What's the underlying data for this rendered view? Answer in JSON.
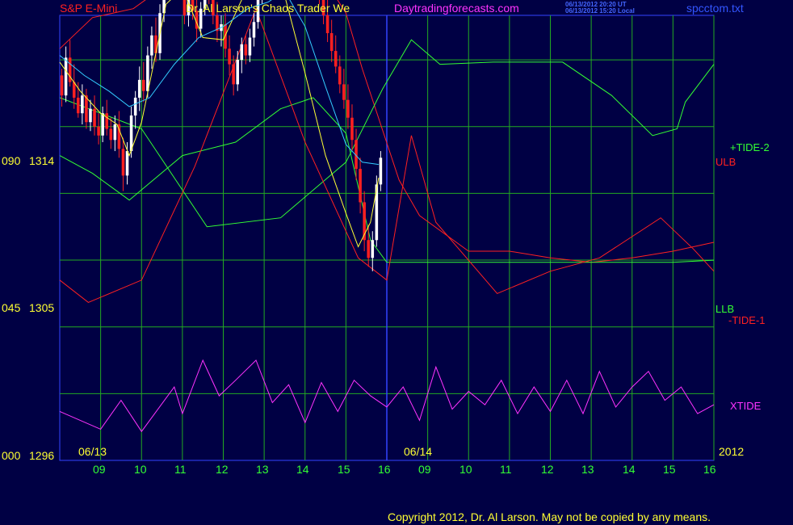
{
  "header": {
    "instrument": "S&P E-Mini",
    "title": "Dr. Al Larson's Chaos Trader We",
    "website": "Daytradingforecasts.com",
    "stamp_ut": "06/13/2012 20:20 UT",
    "stamp_local": "06/13/2012 15:20 Local",
    "filename": "spcctom.txt"
  },
  "y_axis": {
    "labels": [
      {
        "pct": "090",
        "price": "1314"
      },
      {
        "pct": "045",
        "price": "1305"
      },
      {
        "pct": "000",
        "price": "1296"
      }
    ]
  },
  "x_axis": {
    "dates": [
      "06/13",
      "06/14"
    ],
    "year": "2012",
    "hours": [
      "09",
      "10",
      "11",
      "12",
      "13",
      "14",
      "15",
      "16",
      "09",
      "10",
      "11",
      "12",
      "13",
      "14",
      "15",
      "16"
    ]
  },
  "legend": {
    "tide2": "+TIDE-2",
    "ulb": "ULB",
    "llb": "LLB",
    "tide1": "-TIDE-1",
    "xtide": "XTIDE"
  },
  "footer": {
    "copyright": "Copyright 2012, Dr. Al Larson. May not be copied by any means."
  },
  "colors": {
    "background": "#000044",
    "grid": "#22aa22",
    "price_up": "#ffffff",
    "price_down": "#ff2020",
    "average_fast": "#ffff33",
    "average_slow": "#33ccff",
    "upper_band": "#ff2020",
    "lower_band": "#33ff33",
    "xtide": "#ff33ff",
    "divider": "#3344ff"
  },
  "chart_data": {
    "type": "line",
    "ylim": [
      1296,
      1316
    ],
    "y_ticks": [
      1296,
      1305,
      1314
    ],
    "series": [
      {
        "name": "+TIDE-2",
        "color": "#33ff33",
        "x": [
          0,
          2,
          3.6,
          5.4,
          7,
          7.9,
          8.6,
          9.3,
          10.6,
          12.3,
          13.5,
          14.5,
          15.1,
          15.3,
          16
        ],
        "values": [
          1312.3,
          1310.9,
          1306.5,
          1306.9,
          1309.4,
          1312.7,
          1314.9,
          1313.8,
          1313.9,
          1313.9,
          1312.4,
          1310.6,
          1310.9,
          1312.1,
          1313.8
        ]
      },
      {
        "name": "-TIDE-1",
        "color": "#ff2020",
        "x": [
          0,
          0.7,
          2,
          3.3,
          4.8,
          6,
          7.3,
          8,
          8.6,
          9.2,
          10.7,
          12,
          13.2,
          14.7,
          15.5,
          16
        ],
        "values": [
          1304.1,
          1303.1,
          1304.1,
          1309.2,
          1316.3,
          1310.3,
          1305.1,
          1304.1,
          1310.6,
          1306.7,
          1303.5,
          1304.5,
          1305.1,
          1306.9,
          1305.5,
          1304.5
        ]
      },
      {
        "name": "XTIDE",
        "color": "#ff33ff",
        "x": [
          0,
          1,
          1.5,
          2,
          2.8,
          3,
          3.5,
          3.9,
          4.3,
          4.8,
          5.2,
          5.6,
          6,
          6.4,
          6.8,
          7.2,
          7.6,
          8,
          8.4,
          8.8,
          9.2,
          9.6,
          10,
          10.4,
          10.8,
          11.2,
          11.6,
          12,
          12.4,
          12.8,
          13.2,
          13.6,
          14,
          14.4,
          14.8,
          15.2,
          15.6,
          16
        ],
        "values": [
          1298.2,
          1297.4,
          1298.7,
          1297.3,
          1299.3,
          1298.1,
          1300.5,
          1298.9,
          1299.6,
          1300.5,
          1298.6,
          1299.4,
          1297.7,
          1299.5,
          1298.2,
          1299.6,
          1298.9,
          1298.4,
          1299.3,
          1297.8,
          1300.2,
          1298.3,
          1299.1,
          1298.5,
          1299.6,
          1298.1,
          1299.3,
          1298.2,
          1299.6,
          1298.1,
          1300.0,
          1298.4,
          1299.3,
          1300.0,
          1298.7,
          1299.3,
          1298.1,
          1298.5
        ]
      }
    ],
    "bands": [
      {
        "name": "ULB",
        "color": "#ff2020",
        "x": [
          0,
          0.8,
          1.8,
          3,
          4.7,
          5.4,
          6.2,
          7,
          7.4,
          8.3,
          8.8,
          10,
          11,
          12,
          13,
          14,
          15,
          16
        ],
        "values": [
          1314.5,
          1315.9,
          1316.3,
          1317.9,
          1319.5,
          1319.8,
          1318.4,
          1316.1,
          1313.6,
          1308.6,
          1307.0,
          1305.4,
          1305.4,
          1305.1,
          1304.9,
          1305.1,
          1305.4,
          1305.8
        ]
      },
      {
        "name": "LLB",
        "color": "#33ff33",
        "x": [
          0,
          0.8,
          1.7,
          3,
          4.3,
          5.4,
          6.2,
          7,
          7.3,
          7.6,
          8,
          10,
          12,
          13,
          14,
          15,
          16
        ],
        "values": [
          1309.7,
          1308.9,
          1307.7,
          1309.7,
          1310.3,
          1311.8,
          1312.3,
          1310.7,
          1308.3,
          1305.9,
          1304.9,
          1304.9,
          1304.9,
          1304.9,
          1304.9,
          1304.9,
          1305.0
        ]
      }
    ],
    "averages": [
      {
        "name": "fast",
        "color": "#ffff33",
        "x": [
          0,
          0.5,
          1,
          1.4,
          1.7,
          2,
          2.6,
          3,
          3.5,
          4,
          4.6,
          5.1,
          5.5,
          6,
          6.5,
          7,
          7.3,
          7.6,
          7.8
        ],
        "values": [
          1313.9,
          1312.6,
          1311.6,
          1311.1,
          1309.7,
          1311.2,
          1316.5,
          1317.2,
          1315.0,
          1314.9,
          1317.3,
          1317.6,
          1316.9,
          1313.4,
          1309.7,
          1307.1,
          1305.6,
          1306.7,
          1308.7
        ]
      },
      {
        "name": "slow",
        "color": "#33ccff",
        "x": [
          0,
          0.6,
          1.2,
          1.7,
          2.2,
          2.8,
          3.4,
          4,
          4.6,
          5.1,
          5.5,
          6,
          6.5,
          7,
          7.4,
          7.8
        ],
        "values": [
          1314.2,
          1313.3,
          1312.6,
          1311.9,
          1312.3,
          1313.8,
          1315.0,
          1315.5,
          1316.3,
          1316.6,
          1317.1,
          1315.5,
          1312.8,
          1310.2,
          1309.4,
          1309.3
        ]
      }
    ],
    "price": [
      {
        "x": 0.05,
        "o": 1313.3,
        "h": 1313.6,
        "l": 1311.9,
        "c": 1312.4
      },
      {
        "x": 0.15,
        "o": 1312.4,
        "h": 1314.6,
        "l": 1312.1,
        "c": 1314.1
      },
      {
        "x": 0.25,
        "o": 1314.1,
        "h": 1314.9,
        "l": 1312.8,
        "c": 1313.0
      },
      {
        "x": 0.35,
        "o": 1313.0,
        "h": 1313.8,
        "l": 1311.8,
        "c": 1312.3
      },
      {
        "x": 0.45,
        "o": 1312.3,
        "h": 1313.0,
        "l": 1311.4,
        "c": 1311.6
      },
      {
        "x": 0.55,
        "o": 1311.6,
        "h": 1312.9,
        "l": 1311.1,
        "c": 1312.4
      },
      {
        "x": 0.65,
        "o": 1312.4,
        "h": 1312.7,
        "l": 1310.9,
        "c": 1311.2
      },
      {
        "x": 0.75,
        "o": 1311.2,
        "h": 1312.2,
        "l": 1310.8,
        "c": 1311.8
      },
      {
        "x": 0.85,
        "o": 1311.8,
        "h": 1312.4,
        "l": 1310.6,
        "c": 1311.0
      },
      {
        "x": 0.95,
        "o": 1311.0,
        "h": 1311.6,
        "l": 1310.2,
        "c": 1310.6
      },
      {
        "x": 1.05,
        "o": 1310.6,
        "h": 1311.9,
        "l": 1310.3,
        "c": 1311.6
      },
      {
        "x": 1.15,
        "o": 1311.6,
        "h": 1312.2,
        "l": 1310.6,
        "c": 1310.9
      },
      {
        "x": 1.25,
        "o": 1310.9,
        "h": 1311.4,
        "l": 1310.0,
        "c": 1310.4
      },
      {
        "x": 1.35,
        "o": 1310.4,
        "h": 1311.5,
        "l": 1309.9,
        "c": 1311.1
      },
      {
        "x": 1.45,
        "o": 1311.1,
        "h": 1311.7,
        "l": 1309.6,
        "c": 1310.0
      },
      {
        "x": 1.55,
        "o": 1310.0,
        "h": 1310.5,
        "l": 1308.1,
        "c": 1308.8
      },
      {
        "x": 1.65,
        "o": 1308.8,
        "h": 1310.3,
        "l": 1308.4,
        "c": 1309.9
      },
      {
        "x": 1.75,
        "o": 1309.9,
        "h": 1311.9,
        "l": 1309.6,
        "c": 1311.5
      },
      {
        "x": 1.85,
        "o": 1311.5,
        "h": 1312.6,
        "l": 1310.9,
        "c": 1312.3
      },
      {
        "x": 1.95,
        "o": 1312.3,
        "h": 1313.7,
        "l": 1311.7,
        "c": 1313.1
      },
      {
        "x": 2.05,
        "o": 1313.1,
        "h": 1313.9,
        "l": 1312.1,
        "c": 1312.6
      },
      {
        "x": 2.15,
        "o": 1312.6,
        "h": 1314.6,
        "l": 1312.3,
        "c": 1314.2
      },
      {
        "x": 2.25,
        "o": 1314.2,
        "h": 1315.5,
        "l": 1313.6,
        "c": 1315.1
      },
      {
        "x": 2.35,
        "o": 1315.1,
        "h": 1315.9,
        "l": 1313.9,
        "c": 1314.3
      },
      {
        "x": 2.45,
        "o": 1314.3,
        "h": 1316.5,
        "l": 1314.0,
        "c": 1316.1
      },
      {
        "x": 2.55,
        "o": 1316.1,
        "h": 1318.0,
        "l": 1315.7,
        "c": 1317.5
      },
      {
        "x": 2.65,
        "o": 1317.5,
        "h": 1318.6,
        "l": 1316.9,
        "c": 1318.1
      },
      {
        "x": 2.75,
        "o": 1318.1,
        "h": 1319.4,
        "l": 1317.6,
        "c": 1318.9
      },
      {
        "x": 2.85,
        "o": 1318.9,
        "h": 1319.3,
        "l": 1317.8,
        "c": 1318.2
      },
      {
        "x": 2.95,
        "o": 1318.2,
        "h": 1318.6,
        "l": 1316.7,
        "c": 1317.2
      },
      {
        "x": 3.05,
        "o": 1317.2,
        "h": 1317.7,
        "l": 1315.6,
        "c": 1316.0
      },
      {
        "x": 3.15,
        "o": 1316.0,
        "h": 1317.1,
        "l": 1315.5,
        "c": 1316.8
      },
      {
        "x": 3.25,
        "o": 1316.8,
        "h": 1317.3,
        "l": 1315.8,
        "c": 1316.2
      },
      {
        "x": 3.35,
        "o": 1316.2,
        "h": 1316.9,
        "l": 1314.8,
        "c": 1315.4
      },
      {
        "x": 3.45,
        "o": 1315.4,
        "h": 1316.6,
        "l": 1315.0,
        "c": 1316.3
      },
      {
        "x": 3.55,
        "o": 1316.3,
        "h": 1317.8,
        "l": 1316.0,
        "c": 1317.2
      },
      {
        "x": 3.65,
        "o": 1317.2,
        "h": 1318.1,
        "l": 1316.5,
        "c": 1316.9
      },
      {
        "x": 3.75,
        "o": 1316.9,
        "h": 1317.3,
        "l": 1315.6,
        "c": 1316.0
      },
      {
        "x": 3.85,
        "o": 1316.0,
        "h": 1316.6,
        "l": 1314.8,
        "c": 1315.3
      },
      {
        "x": 3.95,
        "o": 1315.3,
        "h": 1316.0,
        "l": 1314.6,
        "c": 1315.6
      },
      {
        "x": 4.05,
        "o": 1315.6,
        "h": 1316.1,
        "l": 1314.1,
        "c": 1314.5
      },
      {
        "x": 4.15,
        "o": 1314.5,
        "h": 1315.1,
        "l": 1313.3,
        "c": 1313.8
      },
      {
        "x": 4.25,
        "o": 1313.8,
        "h": 1314.2,
        "l": 1312.4,
        "c": 1312.9
      },
      {
        "x": 4.35,
        "o": 1312.9,
        "h": 1314.4,
        "l": 1312.6,
        "c": 1314.0
      },
      {
        "x": 4.45,
        "o": 1314.0,
        "h": 1315.0,
        "l": 1313.4,
        "c": 1314.7
      },
      {
        "x": 4.55,
        "o": 1314.7,
        "h": 1315.1,
        "l": 1313.8,
        "c": 1314.2
      },
      {
        "x": 4.65,
        "o": 1314.2,
        "h": 1315.4,
        "l": 1313.9,
        "c": 1315.0
      },
      {
        "x": 4.75,
        "o": 1315.0,
        "h": 1316.1,
        "l": 1314.6,
        "c": 1315.7
      },
      {
        "x": 4.85,
        "o": 1315.7,
        "h": 1317.2,
        "l": 1315.4,
        "c": 1316.8
      },
      {
        "x": 4.95,
        "o": 1316.8,
        "h": 1318.3,
        "l": 1316.5,
        "c": 1317.9
      },
      {
        "x": 5.05,
        "o": 1317.9,
        "h": 1319.1,
        "l": 1317.4,
        "c": 1318.6
      },
      {
        "x": 5.15,
        "o": 1318.6,
        "h": 1318.9,
        "l": 1317.0,
        "c": 1317.6
      },
      {
        "x": 5.25,
        "o": 1317.6,
        "h": 1318.2,
        "l": 1316.9,
        "c": 1317.9
      },
      {
        "x": 5.35,
        "o": 1317.9,
        "h": 1318.4,
        "l": 1316.8,
        "c": 1317.3
      },
      {
        "x": 5.45,
        "o": 1317.3,
        "h": 1318.2,
        "l": 1316.9,
        "c": 1317.8
      },
      {
        "x": 5.55,
        "o": 1317.8,
        "h": 1318.1,
        "l": 1316.9,
        "c": 1317.4
      },
      {
        "x": 5.65,
        "o": 1317.4,
        "h": 1318.3,
        "l": 1317.0,
        "c": 1317.9
      },
      {
        "x": 5.75,
        "o": 1317.9,
        "h": 1318.2,
        "l": 1316.8,
        "c": 1317.2
      },
      {
        "x": 5.85,
        "o": 1317.2,
        "h": 1318.1,
        "l": 1316.9,
        "c": 1317.8
      },
      {
        "x": 5.95,
        "o": 1317.8,
        "h": 1318.4,
        "l": 1317.1,
        "c": 1317.6
      },
      {
        "x": 6.05,
        "o": 1317.6,
        "h": 1318.6,
        "l": 1317.3,
        "c": 1318.2
      },
      {
        "x": 6.15,
        "o": 1318.2,
        "h": 1319.4,
        "l": 1317.9,
        "c": 1319.0
      },
      {
        "x": 6.25,
        "o": 1319.0,
        "h": 1319.3,
        "l": 1317.6,
        "c": 1318.0
      },
      {
        "x": 6.35,
        "o": 1318.0,
        "h": 1318.4,
        "l": 1316.5,
        "c": 1317.0
      },
      {
        "x": 6.45,
        "o": 1317.0,
        "h": 1317.3,
        "l": 1315.6,
        "c": 1316.0
      },
      {
        "x": 6.55,
        "o": 1316.0,
        "h": 1316.7,
        "l": 1314.8,
        "c": 1315.2
      },
      {
        "x": 6.65,
        "o": 1315.2,
        "h": 1315.8,
        "l": 1313.9,
        "c": 1314.4
      },
      {
        "x": 6.75,
        "o": 1314.4,
        "h": 1315.1,
        "l": 1313.4,
        "c": 1313.7
      },
      {
        "x": 6.85,
        "o": 1313.7,
        "h": 1314.2,
        "l": 1312.5,
        "c": 1312.9
      },
      {
        "x": 6.95,
        "o": 1312.9,
        "h": 1313.6,
        "l": 1311.8,
        "c": 1312.2
      },
      {
        "x": 7.05,
        "o": 1312.2,
        "h": 1312.9,
        "l": 1310.9,
        "c": 1311.4
      },
      {
        "x": 7.15,
        "o": 1311.4,
        "h": 1312.0,
        "l": 1309.9,
        "c": 1310.4
      },
      {
        "x": 7.25,
        "o": 1310.4,
        "h": 1310.9,
        "l": 1308.6,
        "c": 1309.1
      },
      {
        "x": 7.35,
        "o": 1309.1,
        "h": 1309.6,
        "l": 1307.1,
        "c": 1307.6
      },
      {
        "x": 7.45,
        "o": 1307.6,
        "h": 1308.1,
        "l": 1305.4,
        "c": 1305.9
      },
      {
        "x": 7.55,
        "o": 1305.9,
        "h": 1306.6,
        "l": 1304.7,
        "c": 1305.1
      },
      {
        "x": 7.65,
        "o": 1305.1,
        "h": 1306.3,
        "l": 1304.5,
        "c": 1305.9
      },
      {
        "x": 7.75,
        "o": 1305.9,
        "h": 1308.8,
        "l": 1305.6,
        "c": 1308.4
      },
      {
        "x": 7.85,
        "o": 1308.4,
        "h": 1309.9,
        "l": 1308.1,
        "c": 1309.6
      }
    ]
  }
}
